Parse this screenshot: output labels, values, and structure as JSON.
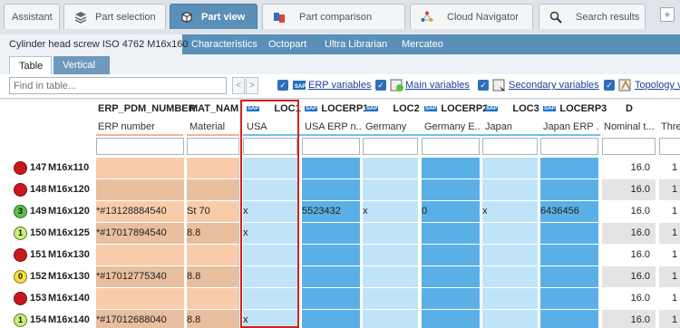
{
  "tabs": [
    {
      "label": "Assistant",
      "icon": "assistant-icon",
      "active": false
    },
    {
      "label": "Part selection",
      "icon": "stack-icon",
      "active": false
    },
    {
      "label": "Part view",
      "icon": "cube-icon",
      "active": true
    },
    {
      "label": "Part comparison",
      "icon": "compare-icon",
      "active": false
    },
    {
      "label": "Cloud Navigator",
      "icon": "cloud-icon",
      "active": false
    },
    {
      "label": "Search results",
      "icon": "search-icon",
      "active": false
    }
  ],
  "plus_label": "+",
  "subtabs": [
    "Cylinder head screw ISO 4762 M16x160",
    "Characteristics",
    "Octopart",
    "Ultra Librarian",
    "Mercateo"
  ],
  "viewtabs": [
    "Table",
    "Vertical"
  ],
  "filterbar": {
    "find_placeholder": "Find in table...",
    "prev": "<",
    "next": ">",
    "checks": [
      "ERP variables",
      "Main variables",
      "Secondary variables",
      "Topology va"
    ]
  },
  "columns": [
    {
      "name": "ERP_PDM_NUMBER",
      "sub": "ERP number"
    },
    {
      "name": "MAT_NAME",
      "sub": "Material"
    },
    {
      "name": "LOC1",
      "sub": "USA",
      "sap": true
    },
    {
      "name": "LOCERP1",
      "sub": "USA ERP n...",
      "sap": true
    },
    {
      "name": "LOC2",
      "sub": "Germany",
      "sap": true
    },
    {
      "name": "LOCERP2",
      "sub": "Germany E...",
      "sap": true
    },
    {
      "name": "LOC3",
      "sub": "Japan",
      "sap": true
    },
    {
      "name": "LOCERP3",
      "sub": "Japan ERP ...",
      "sap": true
    },
    {
      "name": "D",
      "sub": "Nominal t..."
    },
    {
      "name": "",
      "sub": "Thre"
    }
  ],
  "rows": [
    {
      "status": "red",
      "status_label": "",
      "num": "147",
      "type": "M16x110",
      "erp": "",
      "mat": "",
      "loc1": "",
      "locerp1": "",
      "loc2": "",
      "locerp2": "",
      "loc3": "",
      "locerp3": "",
      "d": "16.0",
      "thr": "1"
    },
    {
      "status": "red",
      "status_label": "",
      "num": "148",
      "type": "M16x120",
      "erp": "",
      "mat": "",
      "loc1": "",
      "locerp1": "",
      "loc2": "",
      "locerp2": "",
      "loc3": "",
      "locerp3": "",
      "d": "16.0",
      "thr": "1"
    },
    {
      "status": "green",
      "status_label": "3",
      "num": "149",
      "type": "M16x120",
      "erp": "*#13128884540",
      "mat": "St 70",
      "loc1": "x",
      "locerp1": "5523432",
      "loc2": "x",
      "locerp2": "0",
      "loc3": "x",
      "locerp3": "6436456",
      "d": "16.0",
      "thr": "1"
    },
    {
      "status": "lime",
      "status_label": "1",
      "num": "150",
      "type": "M16x125",
      "erp": "*#17017894540",
      "mat": "8.8",
      "loc1": "x",
      "locerp1": "",
      "loc2": "",
      "locerp2": "",
      "loc3": "",
      "locerp3": "",
      "d": "16.0",
      "thr": "1"
    },
    {
      "status": "red",
      "status_label": "",
      "num": "151",
      "type": "M16x130",
      "erp": "",
      "mat": "",
      "loc1": "",
      "locerp1": "",
      "loc2": "",
      "locerp2": "",
      "loc3": "",
      "locerp3": "",
      "d": "16.0",
      "thr": "1"
    },
    {
      "status": "yellow",
      "status_label": "0",
      "num": "152",
      "type": "M16x130",
      "erp": "*#17012775340",
      "mat": "8.8",
      "loc1": "",
      "locerp1": "",
      "loc2": "",
      "locerp2": "",
      "loc3": "",
      "locerp3": "",
      "d": "16.0",
      "thr": "1"
    },
    {
      "status": "red",
      "status_label": "",
      "num": "153",
      "type": "M16x140",
      "erp": "",
      "mat": "",
      "loc1": "",
      "locerp1": "",
      "loc2": "",
      "locerp2": "",
      "loc3": "",
      "locerp3": "",
      "d": "16.0",
      "thr": "1"
    },
    {
      "status": "lime",
      "status_label": "1",
      "num": "154",
      "type": "M16x140",
      "erp": "*#17012688040",
      "mat": "8.8",
      "loc1": "x",
      "locerp1": "",
      "loc2": "",
      "locerp2": "",
      "loc3": "",
      "locerp3": "",
      "d": "16.0",
      "thr": "1"
    }
  ],
  "colors": {
    "erp_even": "#f8ccab",
    "erp_odd": "#e8bf9f",
    "loc_light": "#bfe4f7",
    "loc_dark": "#5ab0e6",
    "white_even": "#ffffff",
    "white_odd": "#e4e4e4",
    "highlight": "#d62020"
  }
}
